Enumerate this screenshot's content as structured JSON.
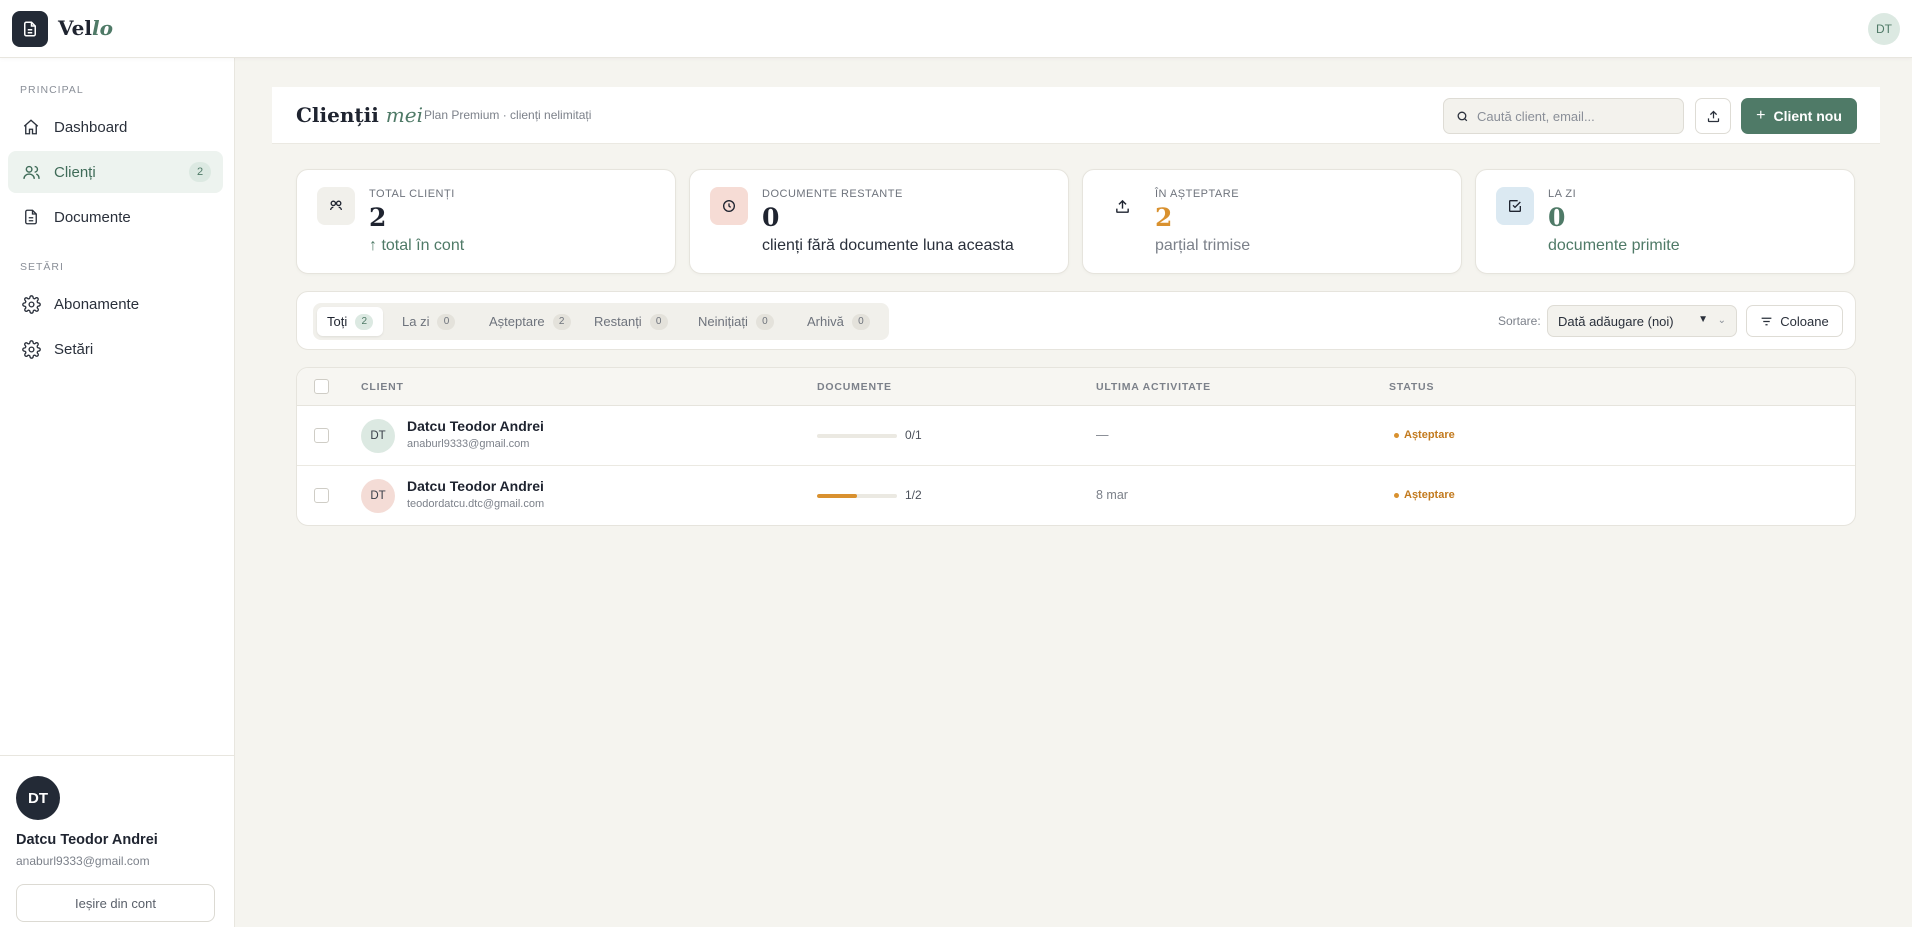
{
  "app": {
    "name_main": "Vel",
    "name_accent": "lo",
    "user_initials": "DT"
  },
  "sidebar": {
    "section_main": "PRINCIPAL",
    "section_settings": "SETĂRI",
    "items": [
      {
        "label": "Dashboard",
        "icon": "home-icon"
      },
      {
        "label": "Clienți",
        "icon": "users-icon",
        "badge": "2"
      },
      {
        "label": "Documente",
        "icon": "document-icon"
      },
      {
        "label": "Abonamente",
        "icon": "gear-icon"
      },
      {
        "label": "Setări",
        "icon": "gear-icon"
      }
    ],
    "user": {
      "initials": "DT",
      "name": "Datcu Teodor Andrei",
      "email": "anaburl9333@gmail.com"
    },
    "logout_label": "Ieșire din cont"
  },
  "header": {
    "title_main": "Clienții",
    "title_accent": "mei",
    "subtitle": "Plan Premium · clienți nelimitați",
    "search_placeholder": "Caută client, email...",
    "new_client_label": "Client nou"
  },
  "stats": [
    {
      "label": "TOTAL CLIENȚI",
      "value": "2",
      "note": "↑ total în cont",
      "icon": "users-circle-icon",
      "color": "#1f2430",
      "note_color": "#4f7a67"
    },
    {
      "label": "DOCUMENTE RESTANTE",
      "value": "0",
      "note": "clienți fără documente luna aceasta",
      "icon": "clock-icon",
      "color": "#1f2430",
      "note_color": "#2a303b"
    },
    {
      "label": "ÎN AȘTEPTARE",
      "value": "2",
      "note": "parțial trimise",
      "icon": "upload-icon",
      "color": "#d9912f",
      "note_color": "#7c818a"
    },
    {
      "label": "LA ZI",
      "value": "0",
      "note": "documente primite",
      "icon": "check-square-icon",
      "color": "#4f7a67",
      "note_color": "#4f7a67"
    }
  ],
  "filters": {
    "tabs": [
      {
        "label": "Toți",
        "count": "2"
      },
      {
        "label": "La zi",
        "count": "0"
      },
      {
        "label": "Așteptare",
        "count": "2"
      },
      {
        "label": "Restanți",
        "count": "0"
      },
      {
        "label": "Neinițiați",
        "count": "0"
      },
      {
        "label": "Arhivă",
        "count": "0"
      }
    ],
    "sort_label": "Sortare:",
    "sort_value": "Dată adăugare (noi)",
    "columns_label": "Coloane"
  },
  "table": {
    "columns": [
      "CLIENT",
      "DOCUMENTE",
      "ULTIMA ACTIVITATE",
      "STATUS"
    ],
    "rows": [
      {
        "initials": "DT",
        "name": "Datcu Teodor Andrei",
        "email": "anaburl9333@gmail.com",
        "docs": "0/1",
        "progress": 0,
        "activity": "—",
        "status": "Așteptare",
        "avatar_bg": "#dce9e2"
      },
      {
        "initials": "DT",
        "name": "Datcu Teodor Andrei",
        "email": "teodordatcu.dtc@gmail.com",
        "docs": "1/2",
        "progress": 0.5,
        "activity": "8 mar",
        "status": "Așteptare",
        "avatar_bg": "#f4dcd6"
      }
    ]
  }
}
